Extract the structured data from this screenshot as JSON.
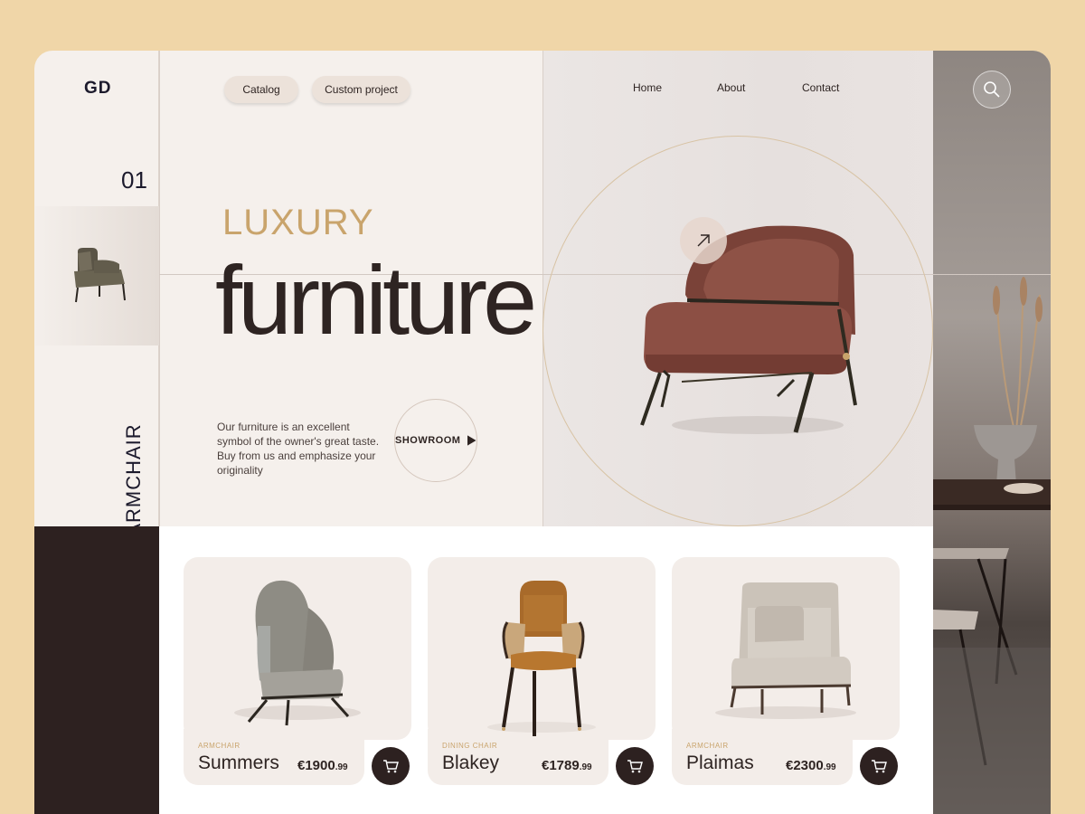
{
  "brand": {
    "logo": "GD"
  },
  "header": {
    "pills": [
      "Catalog",
      "Custom project"
    ],
    "nav": [
      "Home",
      "About",
      "Contact"
    ],
    "search_icon": "search-icon"
  },
  "rail": {
    "number": "01",
    "label": "ARMCHAIR"
  },
  "hero": {
    "eyebrow": "LUXURY",
    "headline": "furniture",
    "blurb": "Our furniture is an excellent symbol of the owner's great taste. Buy from us and emphasize your originality",
    "cta": "SHOWROOM",
    "arrow_icon": "arrow-up-right-icon"
  },
  "products": [
    {
      "category": "ARMCHAIR",
      "name": "Summers",
      "price": "€1900",
      "cents": ".99"
    },
    {
      "category": "DINING CHAIR",
      "name": "Blakey",
      "price": "€1789",
      "cents": ".99"
    },
    {
      "category": "ARMCHAIR",
      "name": "Plaimas",
      "price": "€2300",
      "cents": ".99"
    }
  ],
  "colors": {
    "accent_gold": "#c9a46c",
    "dark_brown": "#2d2120",
    "background": "#f5f0ec",
    "page_bg": "#f0d6a8"
  }
}
